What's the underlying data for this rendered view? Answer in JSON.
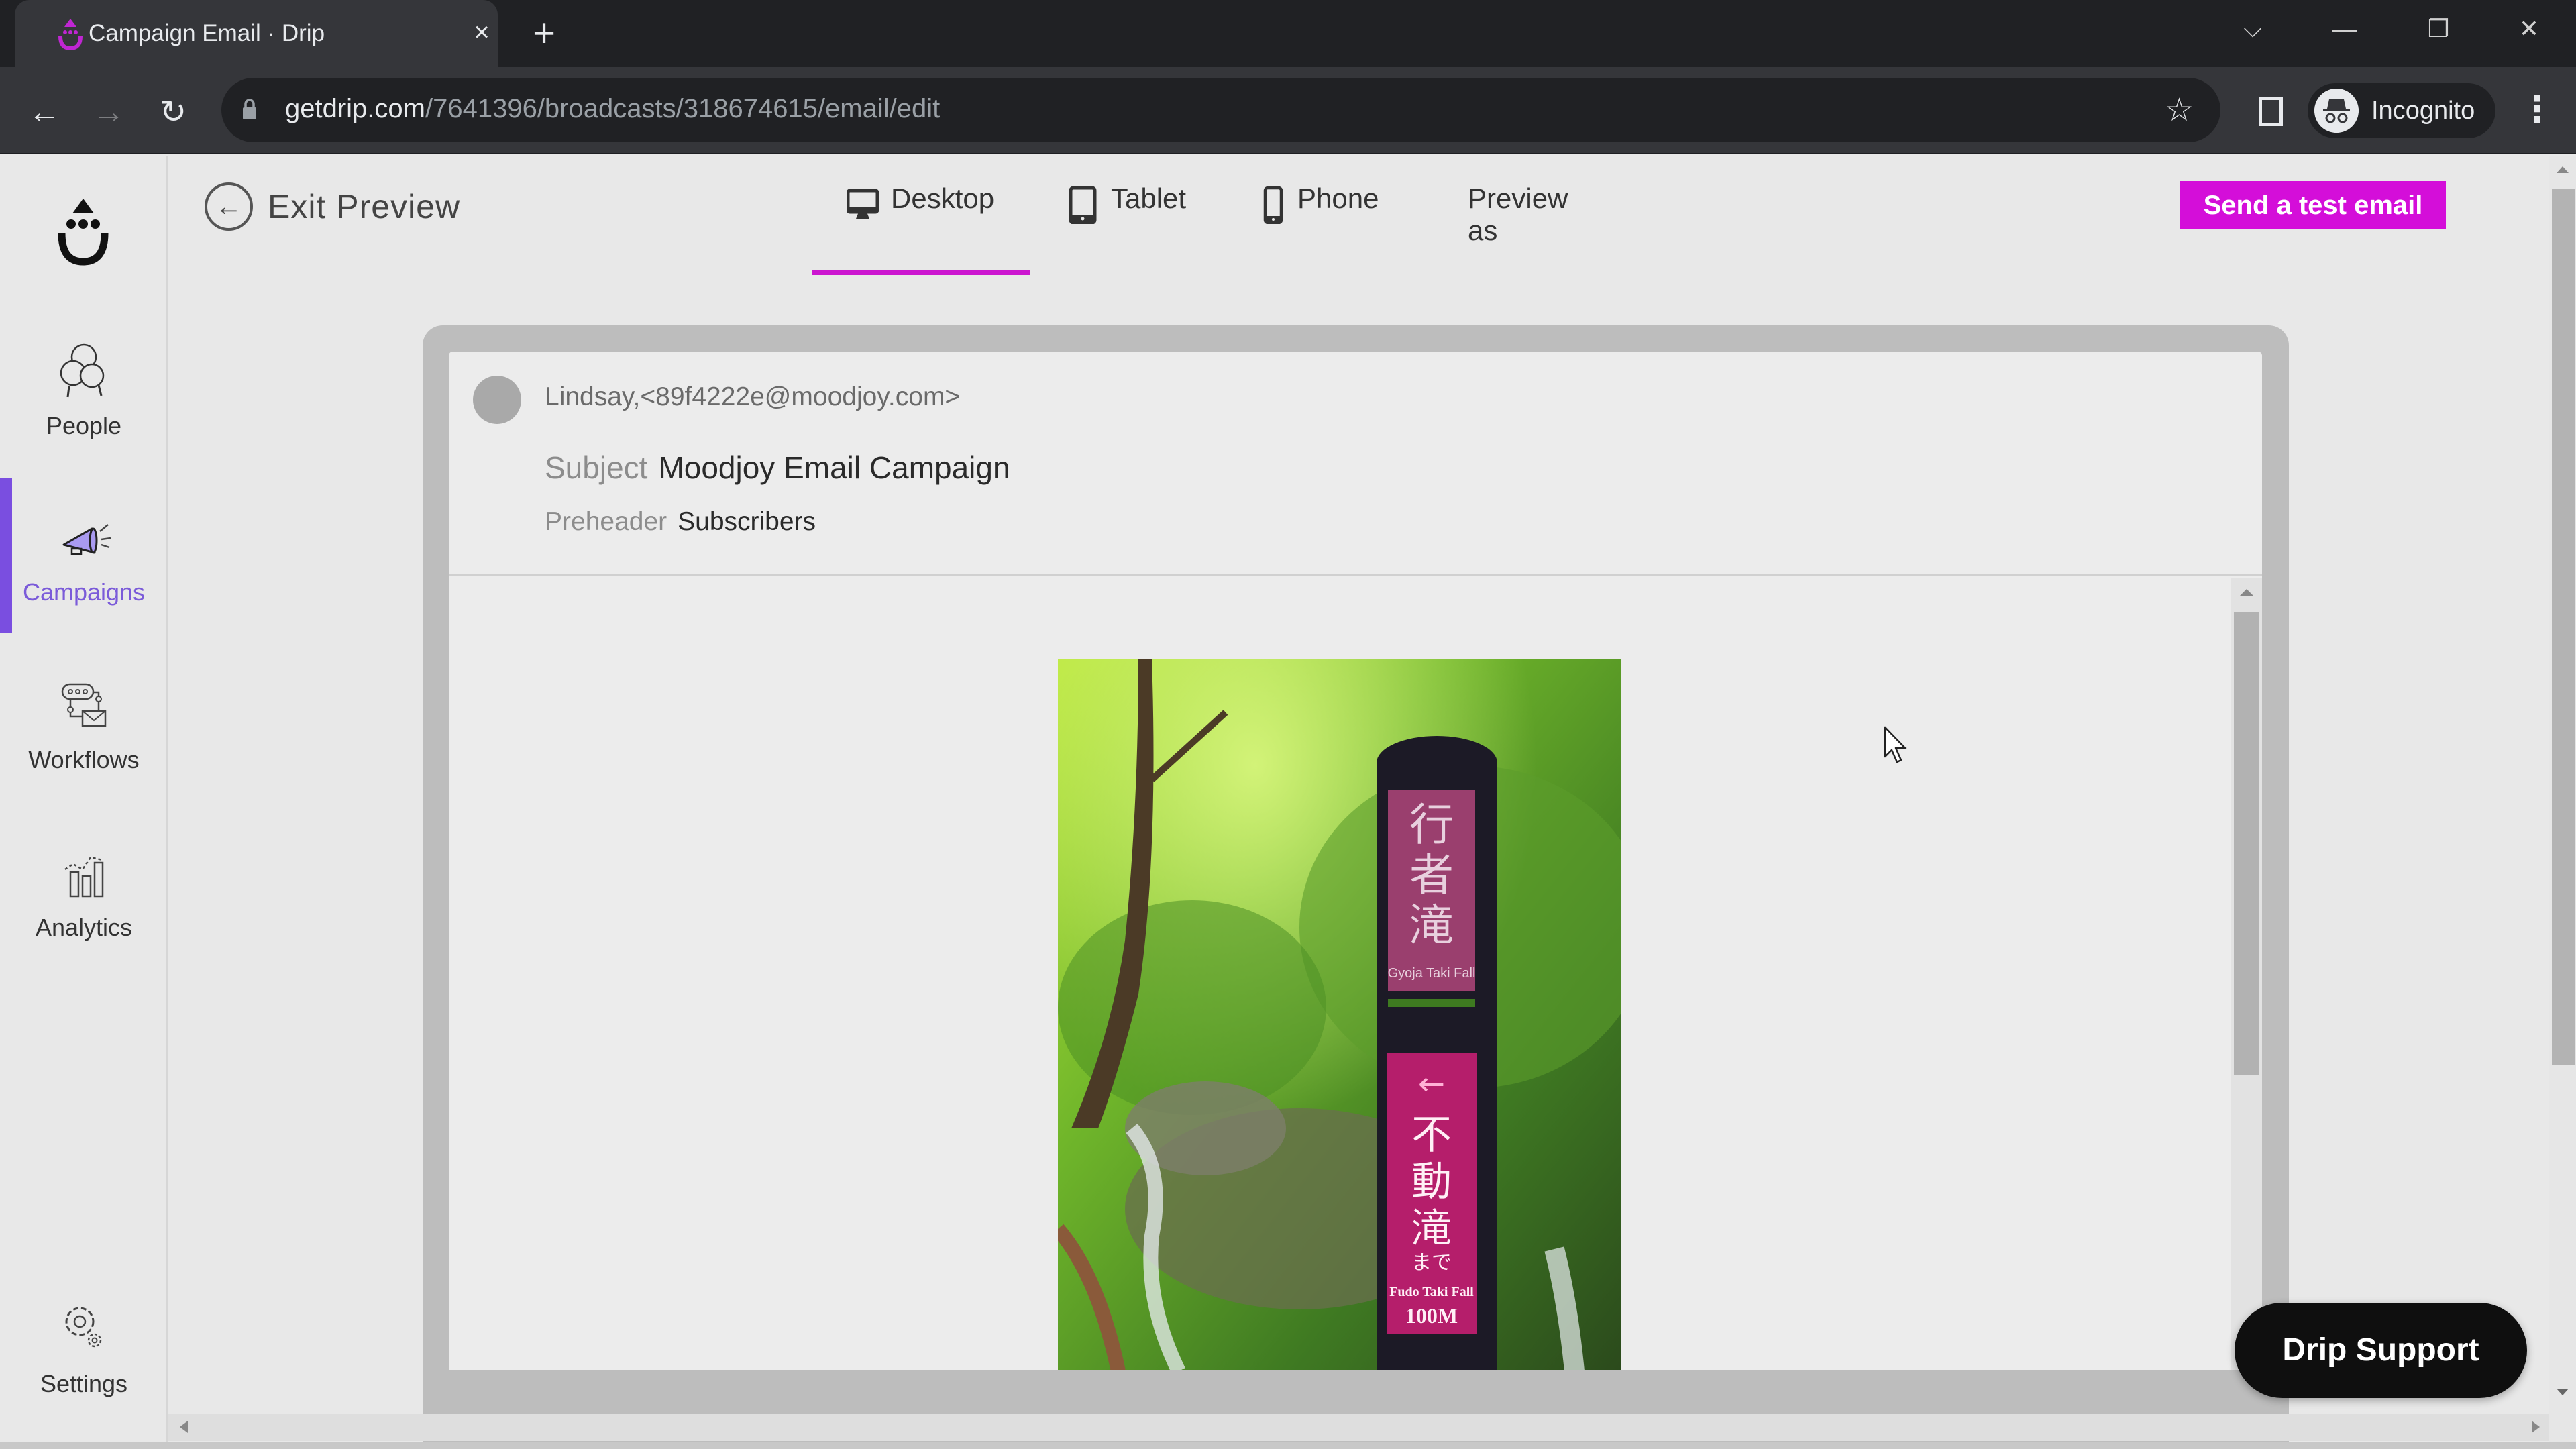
{
  "browser": {
    "tab": {
      "title": "Campaign Email · Drip",
      "favicon": "drip-logo-icon",
      "close_icon": "×"
    },
    "new_tab_icon": "+",
    "window_controls": {
      "tab_search": "⌵",
      "minimize": "—",
      "restore": "❐",
      "close": "✕"
    },
    "nav": {
      "back": "←",
      "forward": "→",
      "reload": "↻"
    },
    "url": {
      "host": "getdrip.com",
      "path": "/7641396/broadcasts/318674615/email/edit"
    },
    "bookmark_icon": "☆",
    "profile": {
      "label": "Incognito"
    },
    "menu_icon": "⋮"
  },
  "sidebar": {
    "logo": "drip-logo",
    "items": [
      {
        "label": "People",
        "icon": "people-icon",
        "active": false
      },
      {
        "label": "Campaigns",
        "icon": "megaphone-icon",
        "active": true
      },
      {
        "label": "Workflows",
        "icon": "workflow-icon",
        "active": false
      },
      {
        "label": "Analytics",
        "icon": "analytics-icon",
        "active": false
      }
    ],
    "settings": {
      "label": "Settings",
      "icon": "gear-icon"
    }
  },
  "toolbar": {
    "exit_label": "Exit Preview",
    "exit_icon": "←",
    "device_tabs": [
      {
        "label": "Desktop",
        "icon": "desktop-icon",
        "active": true
      },
      {
        "label": "Tablet",
        "icon": "tablet-icon",
        "active": false
      },
      {
        "label": "Phone",
        "icon": "phone-icon",
        "active": false
      },
      {
        "label": "Preview as",
        "active": false
      }
    ],
    "send_test_label": "Send a test email"
  },
  "email": {
    "from": "Lindsay,<89f4222e@moodjoy.com>",
    "subject_label": "Subject",
    "subject": "Moodjoy Email Campaign",
    "preheader_label": "Preheader",
    "preheader": "Subscribers",
    "image": {
      "description": "Forest trail signpost with waterfall",
      "sign_top": {
        "kanji": "行者滝",
        "english": "Gyoja Taki Fall"
      },
      "sign_bottom": {
        "arrow": "←",
        "kanji": "不動滝",
        "hiragana": "まで",
        "english": "Fudo Taki Fall",
        "distance": "100M"
      }
    }
  },
  "support": {
    "label": "Drip Support"
  },
  "colors": {
    "brand_magenta": "#d40ed9",
    "active_purple": "#7a4ee0",
    "chrome_dark": "#202124",
    "chrome_mid": "#35363a",
    "page_bg": "#e8e8e8"
  }
}
